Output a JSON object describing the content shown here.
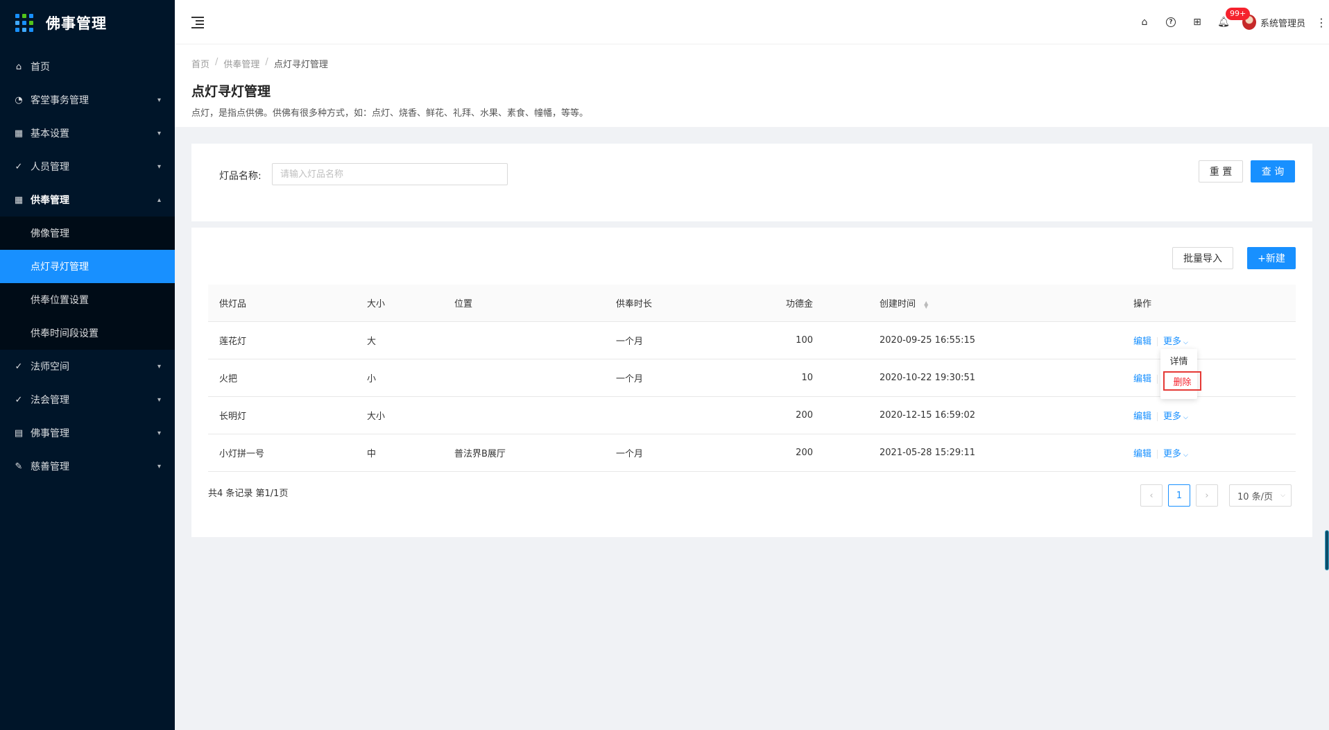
{
  "app": {
    "title": "佛事管理"
  },
  "sidebar": {
    "items": [
      {
        "label": "首页",
        "icon": "home-icon",
        "arrow": ""
      },
      {
        "label": "客堂事务管理",
        "icon": "dashboard-icon",
        "arrow": "⌄"
      },
      {
        "label": "基本设置",
        "icon": "table-icon",
        "arrow": "⌄"
      },
      {
        "label": "人员管理",
        "icon": "check-circle-icon",
        "arrow": "⌄"
      },
      {
        "label": "供奉管理",
        "icon": "table-icon",
        "arrow": "⌃"
      }
    ],
    "sub_items": [
      {
        "label": "佛像管理"
      },
      {
        "label": "点灯寻灯管理"
      },
      {
        "label": "供奉位置设置"
      },
      {
        "label": "供奉时间段设置"
      }
    ],
    "items_after": [
      {
        "label": "法师空间",
        "icon": "check-circle-icon",
        "arrow": "⌄"
      },
      {
        "label": "法会管理",
        "icon": "check-circle-icon",
        "arrow": "⌄"
      },
      {
        "label": "佛事管理",
        "icon": "profile-icon",
        "arrow": "⌄"
      },
      {
        "label": "慈善管理",
        "icon": "form-icon",
        "arrow": "⌄"
      }
    ]
  },
  "header": {
    "notification_badge": "99+",
    "user_name": "系统管理员"
  },
  "breadcrumb": {
    "items": [
      "首页",
      "供奉管理",
      "点灯寻灯管理"
    ],
    "separator": "/"
  },
  "page": {
    "title": "点灯寻灯管理",
    "description": "点灯，是指点供佛。供佛有很多种方式，如：点灯、烧香、鲜花、礼拜、水果、素食、幢幡，等等。"
  },
  "search": {
    "label": "灯品名称:",
    "placeholder": "请输入灯品名称",
    "value": "",
    "reset_label": "重 置",
    "query_label": "查 询"
  },
  "toolbar": {
    "import_label": "批量导入",
    "new_label": "+新建"
  },
  "table": {
    "columns": [
      "供灯品",
      "大小",
      "位置",
      "供奉时长",
      "功德金",
      "创建时间",
      "操作"
    ],
    "rows": [
      {
        "name": "莲花灯",
        "size": "大",
        "location": "",
        "duration": "一个月",
        "merit": "100",
        "created": "2020-09-25 16:55:15"
      },
      {
        "name": "火把",
        "size": "小",
        "location": "",
        "duration": "一个月",
        "merit": "10",
        "created": "2020-10-22 19:30:51"
      },
      {
        "name": "长明灯",
        "size": "大小",
        "location": "",
        "duration": "",
        "merit": "200",
        "created": "2020-12-15 16:59:02"
      },
      {
        "name": "小灯拼一号",
        "size": "中",
        "location": "普法界B展厅",
        "duration": "一个月",
        "merit": "200",
        "created": "2021-05-28 15:29:11"
      }
    ],
    "edit_label": "编辑",
    "more_label": "更多"
  },
  "dropdown": {
    "detail_label": "详情",
    "delete_label": "删除"
  },
  "pagination": {
    "total_text": "共4 条记录 第1/1页",
    "current_page": "1",
    "page_size": "10 条/页",
    "prev": "‹",
    "next": "›"
  }
}
